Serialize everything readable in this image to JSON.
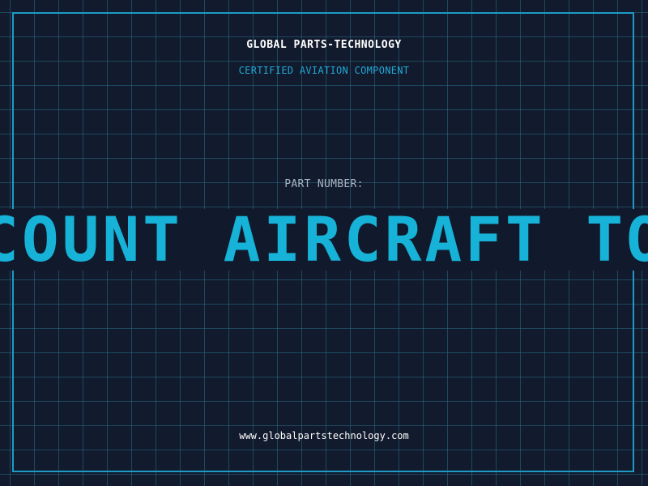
{
  "header": {
    "company": "GLOBAL PARTS-TECHNOLOGY",
    "subtitle": "CERTIFIED AVIATION COMPONENT"
  },
  "part": {
    "label": "PART NUMBER:",
    "value": "DISCOUNT AIRCRAFT TOOLS"
  },
  "footer": {
    "website": "www.globalpartstechnology.com"
  },
  "colors": {
    "background": "#121a2d",
    "grid": "#286e87",
    "frame": "#1d9bc4",
    "accent": "#16b2d8",
    "label": "#a8b4c4",
    "text": "#ffffff"
  }
}
